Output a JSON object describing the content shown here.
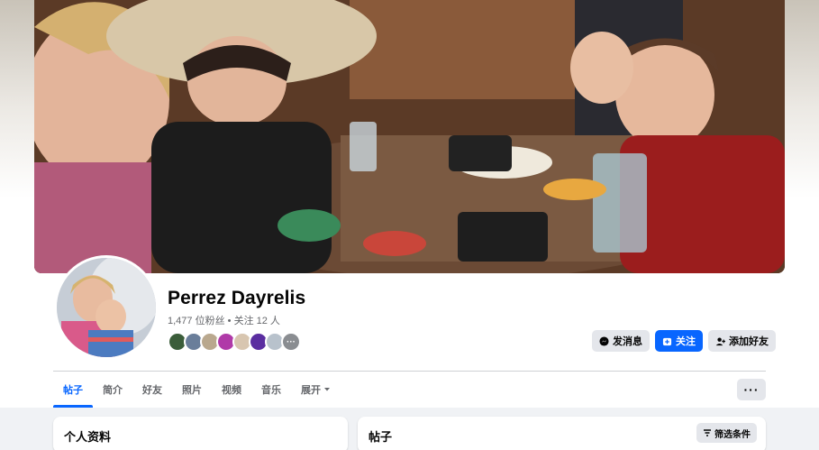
{
  "profile": {
    "name": "Perrez Dayrelis",
    "followers_text": "1,477 位粉丝",
    "separator": "•",
    "following_text": "关注 12 人",
    "friend_more": "···"
  },
  "actions": {
    "message_label": "发消息",
    "follow_label": "关注",
    "add_friend_label": "添加好友"
  },
  "tabs": [
    {
      "label": "帖子"
    },
    {
      "label": "简介"
    },
    {
      "label": "好友"
    },
    {
      "label": "照片"
    },
    {
      "label": "视频"
    },
    {
      "label": "音乐"
    },
    {
      "label": "展开"
    }
  ],
  "more_button": "···",
  "cards": {
    "intro_title": "个人资料",
    "posts_title": "帖子",
    "filter_label": "筛选条件"
  },
  "colors": {
    "accent": "#0866ff",
    "button_gray": "#e4e6eb",
    "secondary_text": "#65676b"
  },
  "icons": {
    "messenger": "messenger-icon",
    "follow": "follow-icon",
    "add_friend": "add-friend-icon",
    "dropdown": "chevron-down-icon",
    "filter": "filter-icon"
  }
}
